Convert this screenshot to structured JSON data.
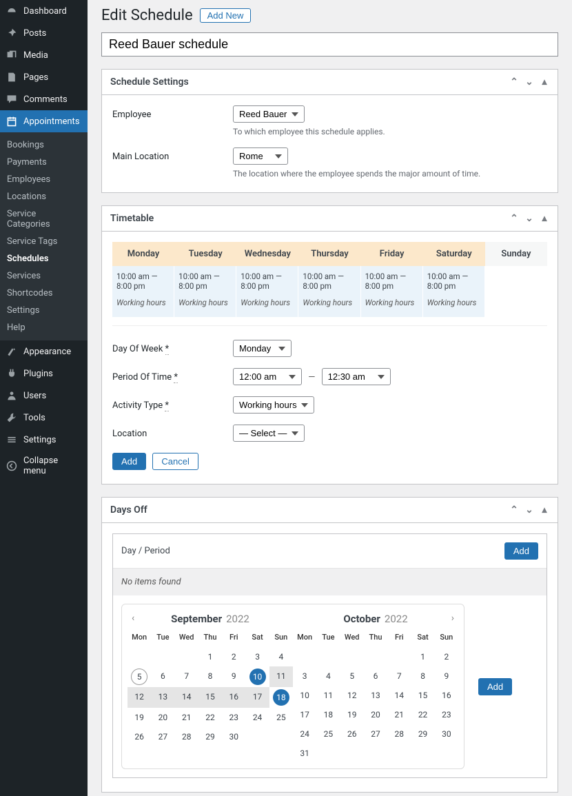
{
  "sidebar": {
    "items": [
      {
        "label": "Dashboard",
        "icon": "dashboard"
      },
      {
        "label": "Posts",
        "icon": "pin"
      },
      {
        "label": "Media",
        "icon": "media"
      },
      {
        "label": "Pages",
        "icon": "pages"
      },
      {
        "label": "Comments",
        "icon": "comments"
      },
      {
        "label": "Appointments",
        "icon": "calendar",
        "active": true
      },
      {
        "label": "Appearance",
        "icon": "appearance"
      },
      {
        "label": "Plugins",
        "icon": "plugins"
      },
      {
        "label": "Users",
        "icon": "users"
      },
      {
        "label": "Tools",
        "icon": "tools"
      },
      {
        "label": "Settings",
        "icon": "settings"
      },
      {
        "label": "Collapse menu",
        "icon": "collapse"
      }
    ],
    "sub": [
      "Bookings",
      "Payments",
      "Employees",
      "Locations",
      "Service Categories",
      "Service Tags",
      "Schedules",
      "Services",
      "Shortcodes",
      "Settings",
      "Help"
    ],
    "sub_selected": "Schedules"
  },
  "header": {
    "title": "Edit Schedule",
    "add_new": "Add New"
  },
  "title_field": "Reed Bauer schedule",
  "settings": {
    "heading": "Schedule Settings",
    "employee_label": "Employee",
    "employee_value": "Reed Bauer",
    "employee_hint": "To which employee this schedule applies.",
    "location_label": "Main Location",
    "location_value": "Rome",
    "location_hint": "The location where the employee spends the major amount of time."
  },
  "timetable": {
    "heading": "Timetable",
    "days": [
      "Monday",
      "Tuesday",
      "Wednesday",
      "Thursday",
      "Friday",
      "Saturday",
      "Sunday"
    ],
    "cells": [
      {
        "time": "10:00 am — 8:00 pm",
        "type": "Working hours"
      },
      {
        "time": "10:00 am — 8:00 pm",
        "type": "Working hours"
      },
      {
        "time": "10:00 am — 8:00 pm",
        "type": "Working hours"
      },
      {
        "time": "10:00 am — 8:00 pm",
        "type": "Working hours"
      },
      {
        "time": "10:00 am — 8:00 pm",
        "type": "Working hours"
      },
      {
        "time": "10:00 am — 8:00 pm",
        "type": "Working hours"
      },
      null
    ],
    "form": {
      "dow_label": "Day Of Week *",
      "dow_value": "Monday",
      "period_label": "Period Of Time *",
      "period_from": "12:00 am",
      "period_to": "12:30 am",
      "activity_label": "Activity Type *",
      "activity_value": "Working hours",
      "loc_label": "Location",
      "loc_value": "— Select —",
      "add": "Add",
      "cancel": "Cancel"
    }
  },
  "daysoff": {
    "heading": "Days Off",
    "dp_label": "Day / Period",
    "add": "Add",
    "empty": "No items found",
    "add2": "Add",
    "cal1": {
      "month": "September",
      "year": "2022",
      "dow": [
        "Mon",
        "Tue",
        "Wed",
        "Thu",
        "Fri",
        "Sat",
        "Sun"
      ],
      "weeks": [
        [
          null,
          null,
          null,
          1,
          2,
          3,
          4
        ],
        [
          5,
          6,
          7,
          8,
          9,
          10,
          11
        ],
        [
          12,
          13,
          14,
          15,
          16,
          17,
          18
        ],
        [
          19,
          20,
          21,
          22,
          23,
          24,
          25
        ],
        [
          26,
          27,
          28,
          29,
          30,
          null,
          null
        ]
      ],
      "today": 5,
      "range_start": 10,
      "range_end": 18
    },
    "cal2": {
      "month": "October",
      "year": "2022",
      "dow": [
        "Mon",
        "Tue",
        "Wed",
        "Thu",
        "Fri",
        "Sat",
        "Sun"
      ],
      "weeks": [
        [
          null,
          null,
          null,
          null,
          null,
          1,
          2
        ],
        [
          3,
          4,
          5,
          6,
          7,
          8,
          9
        ],
        [
          10,
          11,
          12,
          13,
          14,
          15,
          16
        ],
        [
          17,
          18,
          19,
          20,
          21,
          22,
          23
        ],
        [
          24,
          25,
          26,
          27,
          28,
          29,
          30
        ],
        [
          31,
          null,
          null,
          null,
          null,
          null,
          null
        ]
      ]
    }
  }
}
